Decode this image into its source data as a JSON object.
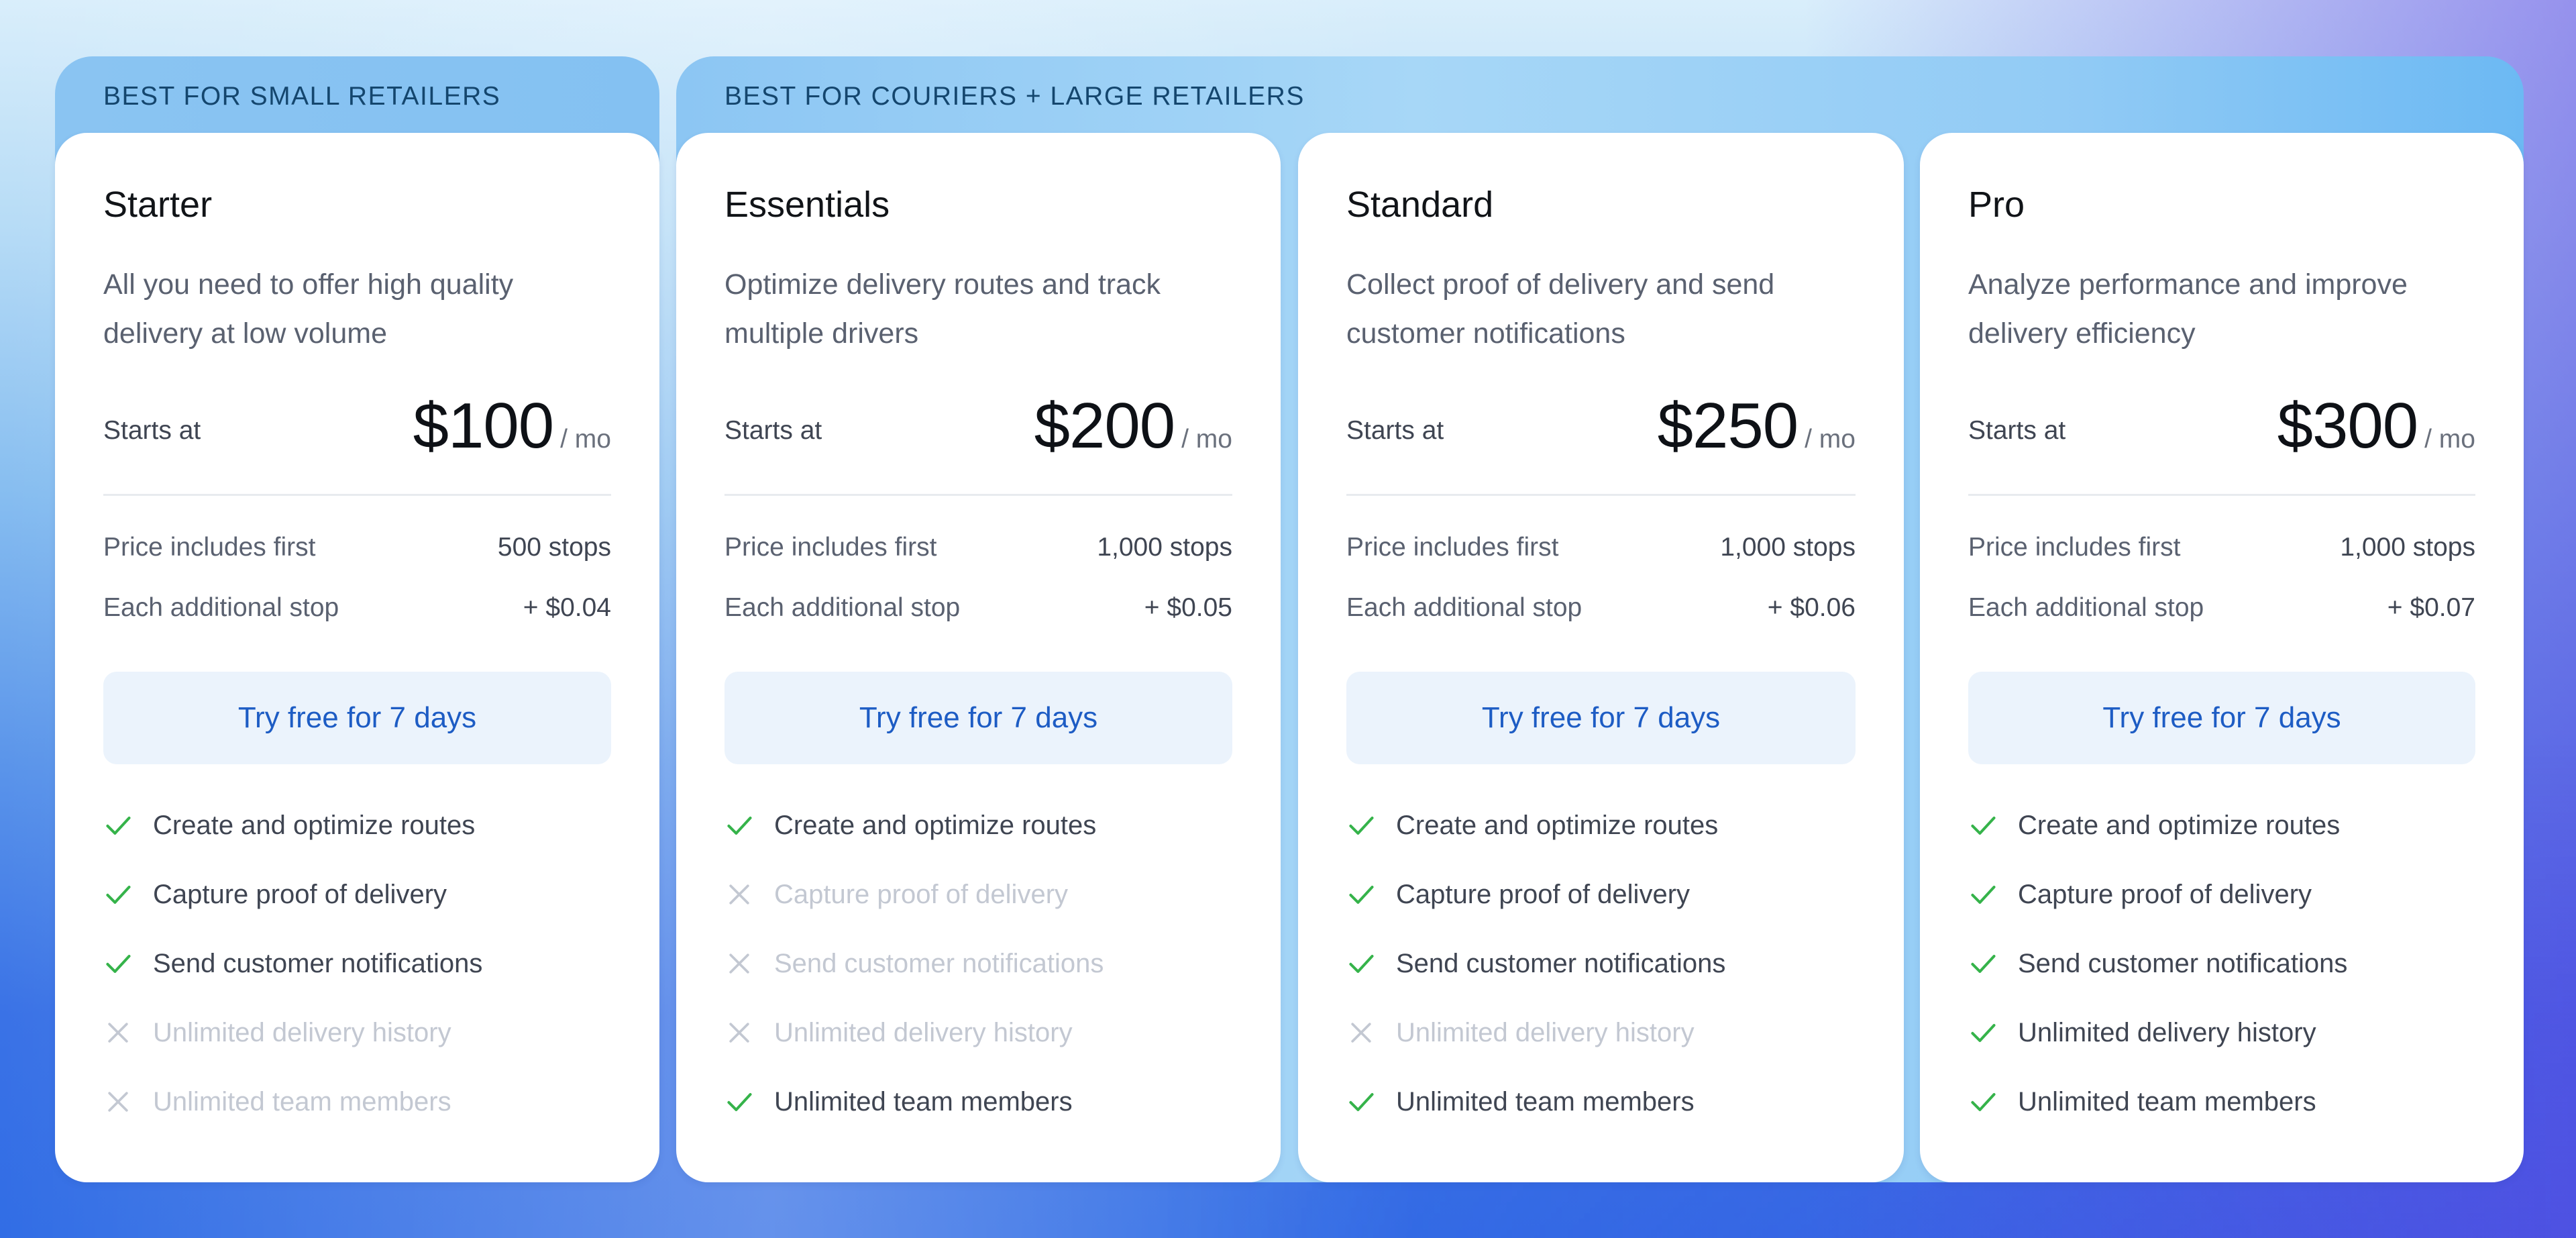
{
  "colors": {
    "accent_blue": "#1d5cc4",
    "check_green": "#35b34a",
    "cross_gray": "#c3c8d2",
    "banner_text": "#14466e",
    "button_bg": "#ebf3fc"
  },
  "groups": [
    {
      "label": "BEST FOR SMALL RETAILERS"
    },
    {
      "label": "BEST FOR COURIERS + LARGE RETAILERS"
    }
  ],
  "plans": [
    {
      "name": "Starter",
      "description": "All you need to offer high quality delivery at low volume",
      "starts_at_label": "Starts at",
      "price": "$100",
      "period": "/ mo",
      "included_label": "Price includes first",
      "included_value": "500 stops",
      "additional_label": "Each additional stop",
      "additional_value": "+ $0.04",
      "cta_label": "Try free for 7 days",
      "features": [
        {
          "label": "Create and optimize routes",
          "included": true,
          "icon": "check-icon"
        },
        {
          "label": "Capture proof of delivery",
          "included": true,
          "icon": "check-icon"
        },
        {
          "label": "Send customer notifications",
          "included": true,
          "icon": "check-icon"
        },
        {
          "label": "Unlimited delivery history",
          "included": false,
          "icon": "x-icon"
        },
        {
          "label": "Unlimited team members",
          "included": false,
          "icon": "x-icon"
        }
      ]
    },
    {
      "name": "Essentials",
      "description": "Optimize delivery routes and track multiple drivers",
      "starts_at_label": "Starts at",
      "price": "$200",
      "period": "/ mo",
      "included_label": "Price includes first",
      "included_value": "1,000 stops",
      "additional_label": "Each additional stop",
      "additional_value": "+ $0.05",
      "cta_label": "Try free for 7 days",
      "features": [
        {
          "label": "Create and optimize routes",
          "included": true,
          "icon": "check-icon"
        },
        {
          "label": "Capture proof of delivery",
          "included": false,
          "icon": "x-icon"
        },
        {
          "label": "Send customer notifications",
          "included": false,
          "icon": "x-icon"
        },
        {
          "label": "Unlimited delivery history",
          "included": false,
          "icon": "x-icon"
        },
        {
          "label": "Unlimited team members",
          "included": true,
          "icon": "check-icon"
        }
      ]
    },
    {
      "name": "Standard",
      "description": "Collect proof of delivery and send customer notifications",
      "starts_at_label": "Starts at",
      "price": "$250",
      "period": "/ mo",
      "included_label": "Price includes first",
      "included_value": "1,000 stops",
      "additional_label": "Each additional stop",
      "additional_value": "+ $0.06",
      "cta_label": "Try free for 7 days",
      "features": [
        {
          "label": "Create and optimize routes",
          "included": true,
          "icon": "check-icon"
        },
        {
          "label": "Capture proof of delivery",
          "included": true,
          "icon": "check-icon"
        },
        {
          "label": "Send customer notifications",
          "included": true,
          "icon": "check-icon"
        },
        {
          "label": "Unlimited delivery history",
          "included": false,
          "icon": "x-icon"
        },
        {
          "label": "Unlimited team members",
          "included": true,
          "icon": "check-icon"
        }
      ]
    },
    {
      "name": "Pro",
      "description": "Analyze performance and improve delivery efficiency",
      "starts_at_label": "Starts at",
      "price": "$300",
      "period": "/ mo",
      "included_label": "Price includes first",
      "included_value": "1,000 stops",
      "additional_label": "Each additional stop",
      "additional_value": "+ $0.07",
      "cta_label": "Try free for 7 days",
      "features": [
        {
          "label": "Create and optimize routes",
          "included": true,
          "icon": "check-icon"
        },
        {
          "label": "Capture proof of delivery",
          "included": true,
          "icon": "check-icon"
        },
        {
          "label": "Send customer notifications",
          "included": true,
          "icon": "check-icon"
        },
        {
          "label": "Unlimited delivery history",
          "included": true,
          "icon": "check-icon"
        },
        {
          "label": "Unlimited team members",
          "included": true,
          "icon": "check-icon"
        }
      ]
    }
  ]
}
